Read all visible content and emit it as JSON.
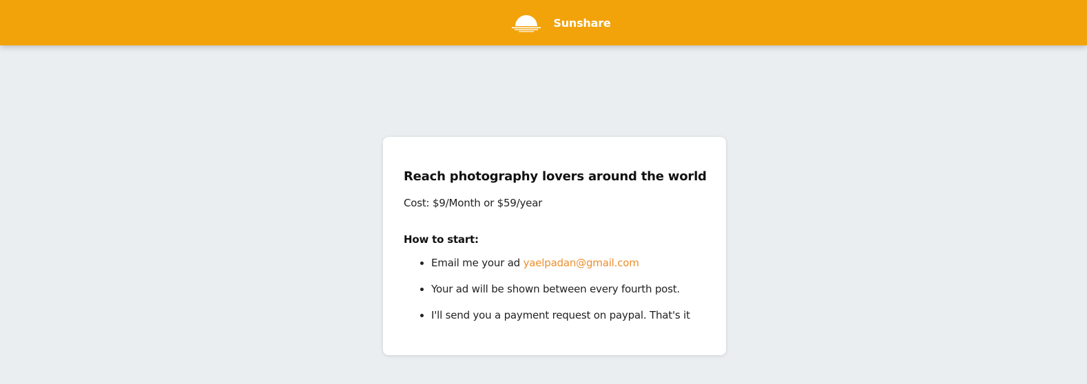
{
  "header": {
    "brand_name": "Sunshare",
    "logo_icon": "sunset-icon",
    "background_color": "#f2a30a"
  },
  "card": {
    "title": "Reach photography lovers around the world",
    "cost": "Cost: $9/Month or $59/year",
    "how_to_start": "How to start:",
    "steps": [
      {
        "text": "Email me your ad ",
        "link_text": "yaelpadan@gmail.com"
      },
      {
        "text": "Your ad will be shown between every fourth post."
      },
      {
        "text": "I'll send you a payment request on paypal. That's it"
      }
    ],
    "link_color": "#ec8f2e"
  }
}
